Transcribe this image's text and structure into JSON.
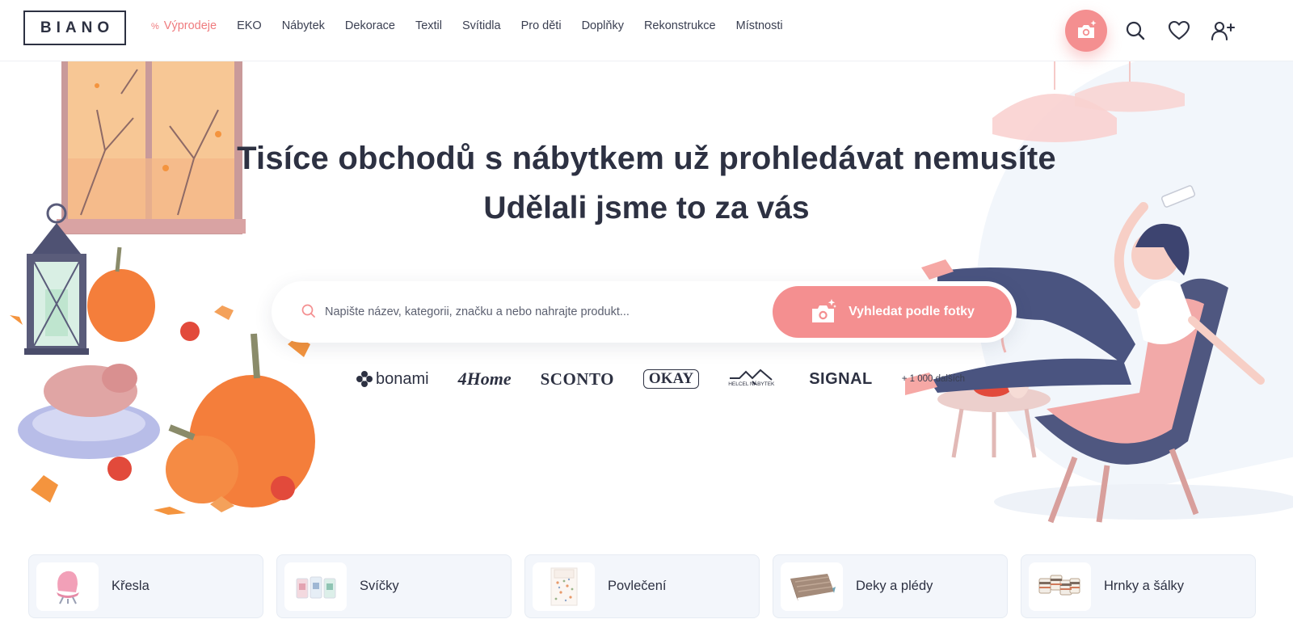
{
  "header": {
    "logo": "BIANO",
    "nav": [
      {
        "label": "Výprodeje",
        "prefix": "%",
        "highlight": true
      },
      {
        "label": "EKO"
      },
      {
        "label": "Nábytek"
      },
      {
        "label": "Dekorace"
      },
      {
        "label": "Textil"
      },
      {
        "label": "Svítidla"
      },
      {
        "label": "Pro děti"
      },
      {
        "label": "Doplňky"
      },
      {
        "label": "Rekonstrukce"
      },
      {
        "label": "Místnosti"
      }
    ],
    "icons": [
      "camera-search-icon",
      "search-icon",
      "heart-icon",
      "user-add-icon"
    ]
  },
  "hero": {
    "title": "Tisíce obchodů s nábytkem už prohledávat nemusíte",
    "subtitle": "Udělali jsme to za vás",
    "search": {
      "placeholder": "Napište název, kategorii, značku a nebo nahrajte produkt...",
      "value": "",
      "photo_button": "Vyhledat podle fotky"
    },
    "brands": [
      "bonami",
      "4Home",
      "SCONTO",
      "OKAY",
      "HELCEL NÁBYTEK",
      "SIGNAL"
    ],
    "brands_more": "+ 1 000 dalších"
  },
  "categories": [
    {
      "label": "Křesla",
      "icon": "armchair-icon"
    },
    {
      "label": "Svíčky",
      "icon": "candles-icon"
    },
    {
      "label": "Povlečení",
      "icon": "bedding-icon"
    },
    {
      "label": "Deky a plédy",
      "icon": "blanket-icon"
    },
    {
      "label": "Hrnky a šálky",
      "icon": "mugs-icon"
    }
  ],
  "colors": {
    "accent": "#f48f90",
    "sale": "#ef7b7e",
    "text": "#2d3142",
    "card_bg": "#f3f6fb",
    "pumpkin": "#f47e3b"
  }
}
